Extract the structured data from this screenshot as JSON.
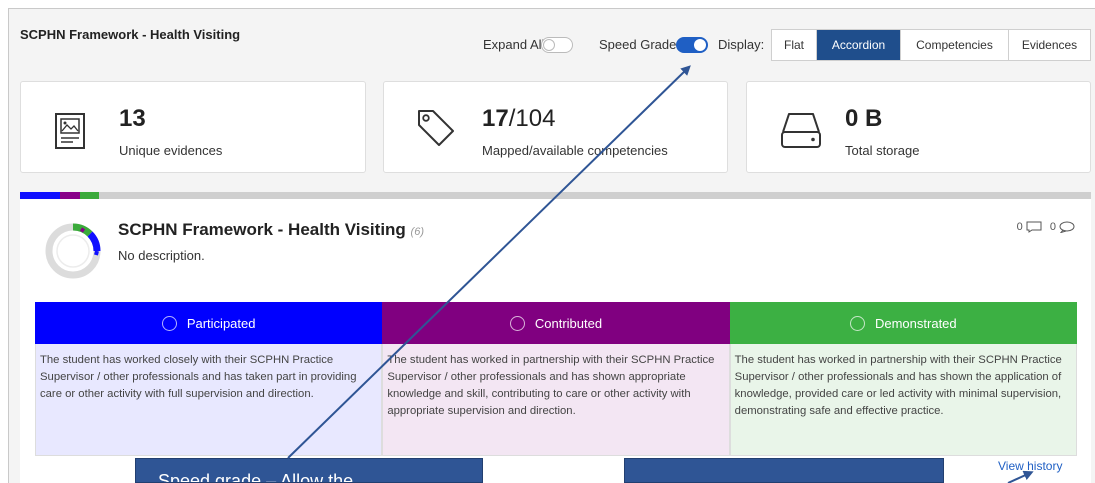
{
  "header": {
    "title": "SCPHN Framework - Health Visiting",
    "expand_all_label": "Expand All:",
    "speed_grade_label": "Speed Grade:",
    "display_label": "Display:",
    "expand_all_on": false,
    "speed_grade_on": true,
    "display_options": [
      "Flat",
      "Accordion",
      "Competencies",
      "Evidences"
    ],
    "display_selected": "Accordion"
  },
  "stats": [
    {
      "value": "13",
      "total": "",
      "label": "Unique evidences",
      "icon": "evidence-icon"
    },
    {
      "value": "17",
      "total": "/104",
      "label": "Mapped/available competencies",
      "icon": "tag-icon"
    },
    {
      "value": "0 B",
      "total": "",
      "label": "Total storage",
      "icon": "hard-drive-icon"
    }
  ],
  "progress": {
    "segments": [
      {
        "name": "Participated",
        "color": "#1010ff"
      },
      {
        "name": "Contributed",
        "color": "#880088"
      },
      {
        "name": "Demonstrated",
        "color": "#3aaa3a"
      }
    ]
  },
  "framework": {
    "title": "SCPHN Framework - Health Visiting",
    "count": "(6)",
    "description": "No description.",
    "files_count": "0",
    "comments_count": "0"
  },
  "grades": [
    {
      "label": "Participated",
      "color": "#0000ff",
      "body_bg": "#e8e8ff",
      "text": "The student has worked closely with their SCPHN Practice Supervisor / other professionals and has taken part in providing care or other activity with full supervision and direction."
    },
    {
      "label": "Contributed",
      "color": "#800080",
      "body_bg": "#f3e6f3",
      "text": "The student has worked in partnership with their SCPHN Practice Supervisor / other professionals and has shown appropriate knowledge and skill, contributing to care or other activity with appropriate supervision and direction."
    },
    {
      "label": "Demonstrated",
      "color": "#3cb043",
      "body_bg": "#e9f5e9",
      "text": "The student has worked in partnership with their SCPHN Practice Supervisor / other professionals and has shown the application of knowledge, provided care or led activity with minimal supervision, demonstrating safe and effective practice."
    }
  ],
  "view_history": "View history",
  "callouts": {
    "speed_grade": "Speed grade – Allow the",
    "second": ""
  }
}
